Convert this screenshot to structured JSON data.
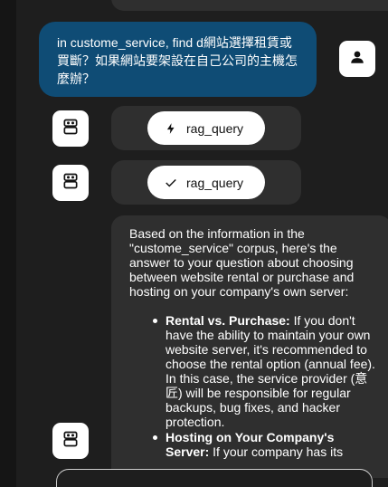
{
  "user_message": {
    "text": "in custome_service, find d網站選擇租賃或買斷？如果網站要架設在自己公司的主機怎麼辦？"
  },
  "tool_calls": [
    {
      "label": "rag_query",
      "icon": "bolt-icon"
    },
    {
      "label": "rag_query",
      "icon": "check-icon"
    }
  ],
  "answer": {
    "intro": "Based on the information in the \"custome_service\" corpus, here's the answer to your question about choosing between website rental or purchase and hosting on your company's own server:",
    "items": [
      {
        "heading": "Rental vs. Purchase:",
        "text": " If you don't have the ability to maintain your own website server, it's recommended to choose the rental option (annual fee). In this case, the service provider (意匠) will be responsible for regular backups, bug fixes, and hacker protection."
      },
      {
        "heading": "Hosting on Your Company's Server:",
        "text": " If your company has its"
      }
    ]
  },
  "colors": {
    "background": "#1e1e1e",
    "user_bubble": "#0f4c75",
    "assistant_bubble": "#2f2f2f",
    "chip": "#ffffff"
  }
}
